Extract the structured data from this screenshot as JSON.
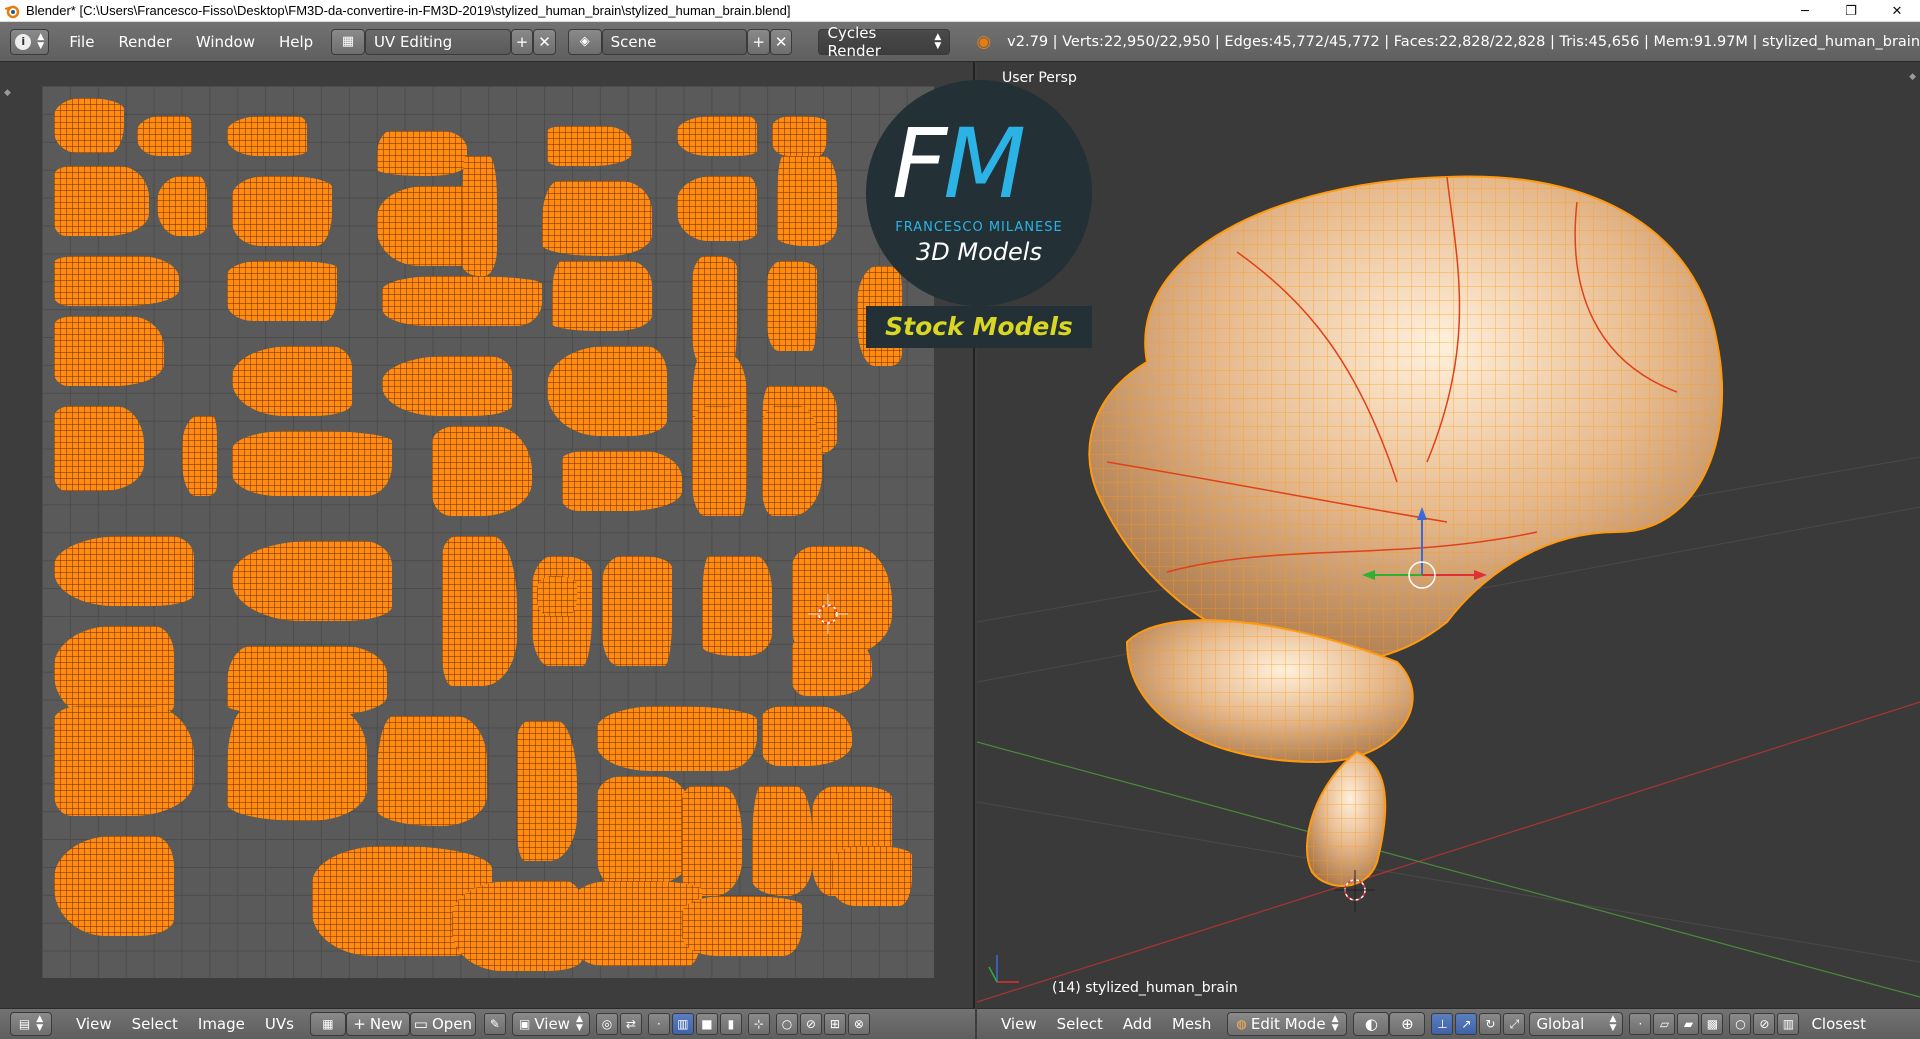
{
  "window": {
    "title": "Blender* [C:\\Users\\Francesco-Fisso\\Desktop\\FM3D-da-convertire-in-FM3D-2019\\stylized_human_brain\\stylized_human_brain.blend]",
    "minimize": "─",
    "maximize": "❐",
    "close": "✕"
  },
  "info_header": {
    "menus": [
      "File",
      "Render",
      "Window",
      "Help"
    ],
    "screen_layout": "UV Editing",
    "scene": "Scene",
    "render_engine": "Cycles Render",
    "stats": "v2.79 | Verts:22,950/22,950 | Edges:45,772/45,772 | Faces:22,828/22,828 | Tris:45,656 | Mem:91.97M | stylized_human_brain"
  },
  "uv_editor": {
    "menus": [
      "View",
      "Select",
      "Image",
      "UVs"
    ],
    "new_label": "New",
    "open_label": "Open",
    "view_label": "View"
  },
  "viewport": {
    "view_name": "User Persp",
    "object_label": "(14) stylized_human_brain",
    "menus": [
      "View",
      "Select",
      "Add",
      "Mesh"
    ],
    "mode": "Edit Mode",
    "orientation": "Global",
    "snap_target": "Closest"
  },
  "watermark": {
    "letter_f": "F",
    "letter_m": "M",
    "brand": "FRANCESCO MILANESE",
    "subtitle": "3D Models",
    "tagline": "Stock Models"
  },
  "colors": {
    "uv_islands": "#ff8c10",
    "accent_blue": "#2cb3e6",
    "tagline_yellow": "#d9d624"
  }
}
